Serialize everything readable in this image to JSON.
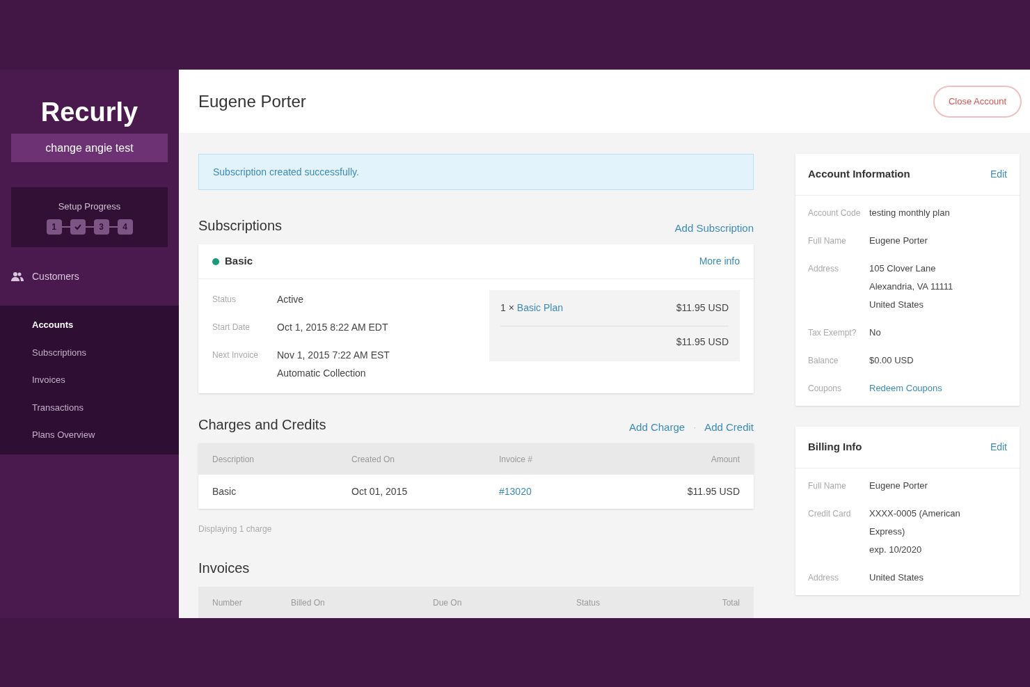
{
  "sidebar": {
    "logo": "Recurly",
    "site": "change angie test",
    "setup": {
      "title": "Setup Progress",
      "steps": [
        {
          "label": "1",
          "done": false
        },
        {
          "done": true
        },
        {
          "label": "3",
          "done": false
        },
        {
          "label": "4",
          "done": false
        }
      ]
    },
    "section": "Customers",
    "items": [
      {
        "label": "Accounts",
        "selected": true
      },
      {
        "label": "Subscriptions",
        "selected": false
      },
      {
        "label": "Invoices",
        "selected": false
      },
      {
        "label": "Transactions",
        "selected": false
      },
      {
        "label": "Plans Overview",
        "selected": false
      }
    ]
  },
  "header": {
    "title": "Eugene Porter",
    "button": "Close Account"
  },
  "alert": "Subscription created successfully.",
  "subscriptions": {
    "title": "Subscriptions",
    "action": "Add Subscription",
    "card": {
      "name": "Basic",
      "color": "#1a9a7a",
      "link": "More info",
      "fields": [
        {
          "label": "Status",
          "lines": [
            "Active"
          ]
        },
        {
          "label": "Start Date",
          "lines": [
            "Oct 1, 2015 8:22 AM EDT"
          ]
        },
        {
          "label": "Next Invoice",
          "lines": [
            "Nov 1, 2015 7:22 AM EST",
            "Automatic Collection"
          ]
        }
      ],
      "line_item": {
        "qty": "1 ×",
        "plan": "Basic Plan",
        "price": "$11.95 USD",
        "total": "$11.95 USD"
      }
    }
  },
  "charges": {
    "title": "Charges and Credits",
    "actions": [
      "Add Charge",
      "Add Credit"
    ],
    "separator": "·",
    "columns": [
      "Description",
      "Created On",
      "Invoice #",
      "Amount"
    ],
    "rows": [
      [
        "Basic",
        "Oct 01, 2015",
        "#13020",
        "$11.95 USD"
      ]
    ],
    "footer": "Displaying 1 charge"
  },
  "invoices": {
    "title": "Invoices",
    "columns": [
      "Number",
      "Billed On",
      "Due On",
      "Status",
      "Total"
    ]
  },
  "account_info": {
    "title": "Account Information",
    "edit": "Edit",
    "fields": [
      {
        "label": "Account Code",
        "kind": "text",
        "lines": [
          "testing monthly plan"
        ]
      },
      {
        "label": "Full Name",
        "kind": "text",
        "lines": [
          "Eugene Porter"
        ]
      },
      {
        "label": "Address",
        "kind": "text",
        "lines": [
          "105 Clover Lane",
          "Alexandria, VA 11111",
          "United States"
        ]
      },
      {
        "label": "Tax Exempt?",
        "kind": "text",
        "lines": [
          "No"
        ]
      },
      {
        "label": "Balance",
        "kind": "text",
        "lines": [
          "$0.00 USD"
        ]
      },
      {
        "label": "Coupons",
        "kind": "link",
        "lines": [
          "Redeem Coupons"
        ]
      }
    ]
  },
  "billing_info": {
    "title": "Billing Info",
    "edit": "Edit",
    "fields": [
      {
        "label": "Full Name",
        "kind": "text",
        "lines": [
          "Eugene Porter"
        ]
      },
      {
        "label": "Credit Card",
        "kind": "text",
        "lines": [
          "XXXX-0005 (American",
          "Express)",
          "exp. 10/2020"
        ]
      },
      {
        "label": "Address",
        "kind": "text",
        "lines": [
          "United States"
        ]
      }
    ]
  }
}
